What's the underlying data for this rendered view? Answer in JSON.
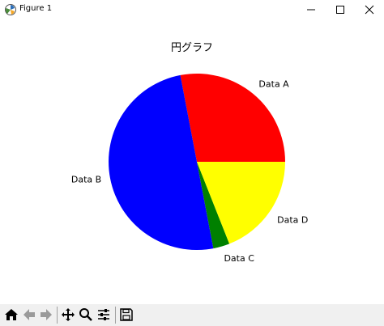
{
  "window": {
    "title": "Figure 1",
    "icon": "matplotlib-icon",
    "controls": [
      "minimize-icon",
      "maximize-icon",
      "close-icon"
    ]
  },
  "toolbar": {
    "buttons": [
      "home-icon",
      "back-arrow-icon",
      "forward-arrow-icon",
      "pan-icon",
      "zoom-icon",
      "configure-subplots-icon",
      "save-icon"
    ]
  },
  "chart_data": {
    "type": "pie",
    "title": "円グラフ",
    "labels": [
      "Data A",
      "Data B",
      "Data C",
      "Data D"
    ],
    "values": [
      28,
      50,
      3,
      19
    ],
    "colors": [
      "#ff0000",
      "#0000ff",
      "#008000",
      "#ffff00"
    ],
    "start_angle_deg": 0,
    "direction": "counterclockwise",
    "legend": "none"
  }
}
